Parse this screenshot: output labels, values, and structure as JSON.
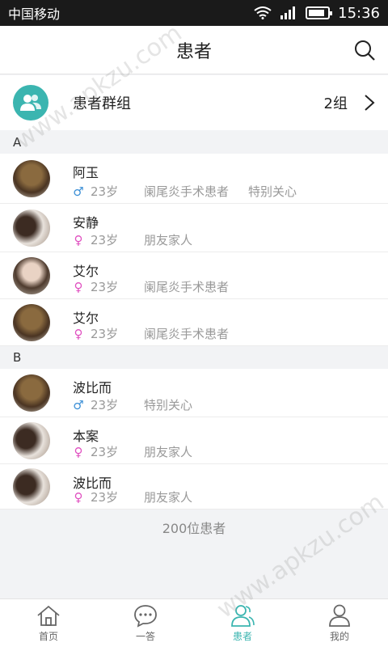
{
  "status": {
    "carrier": "中国移动",
    "time": "15:36",
    "battery_level": 0.85
  },
  "header": {
    "title": "患者"
  },
  "group": {
    "label": "患者群组",
    "count": "2组"
  },
  "sections": [
    "A",
    "B"
  ],
  "patients": [
    {
      "name": "阿玉",
      "gender": "♂",
      "age": "23岁",
      "tags": [
        "阑尾炎手术患者",
        "特别关心"
      ]
    },
    {
      "name": "安静",
      "gender": "♀",
      "age": "23岁",
      "tags": [
        "朋友家人"
      ]
    },
    {
      "name": "艾尔",
      "gender": "♀",
      "age": "23岁",
      "tags": [
        "阑尾炎手术患者"
      ]
    },
    {
      "name": "艾尔",
      "gender": "♀",
      "age": "23岁",
      "tags": [
        "阑尾炎手术患者"
      ]
    },
    {
      "name": "波比而",
      "gender": "♂",
      "age": "23岁",
      "tags": [
        "特别关心"
      ]
    },
    {
      "name": "本案",
      "gender": "♀",
      "age": "23岁",
      "tags": [
        "朋友家人"
      ]
    },
    {
      "name": "波比而",
      "gender": "♀",
      "age": "23岁",
      "tags": [
        "朋友家人"
      ]
    }
  ],
  "footer": {
    "count": "200位患者"
  },
  "tabs": [
    {
      "label": "首页"
    },
    {
      "label": "一答"
    },
    {
      "label": "患者"
    },
    {
      "label": "我的"
    }
  ],
  "watermark": {
    "text": "www.apkzu.com"
  },
  "colors": {
    "accent": "#3bb5b0",
    "male": "#3b8fd6",
    "female": "#e04fc0"
  }
}
